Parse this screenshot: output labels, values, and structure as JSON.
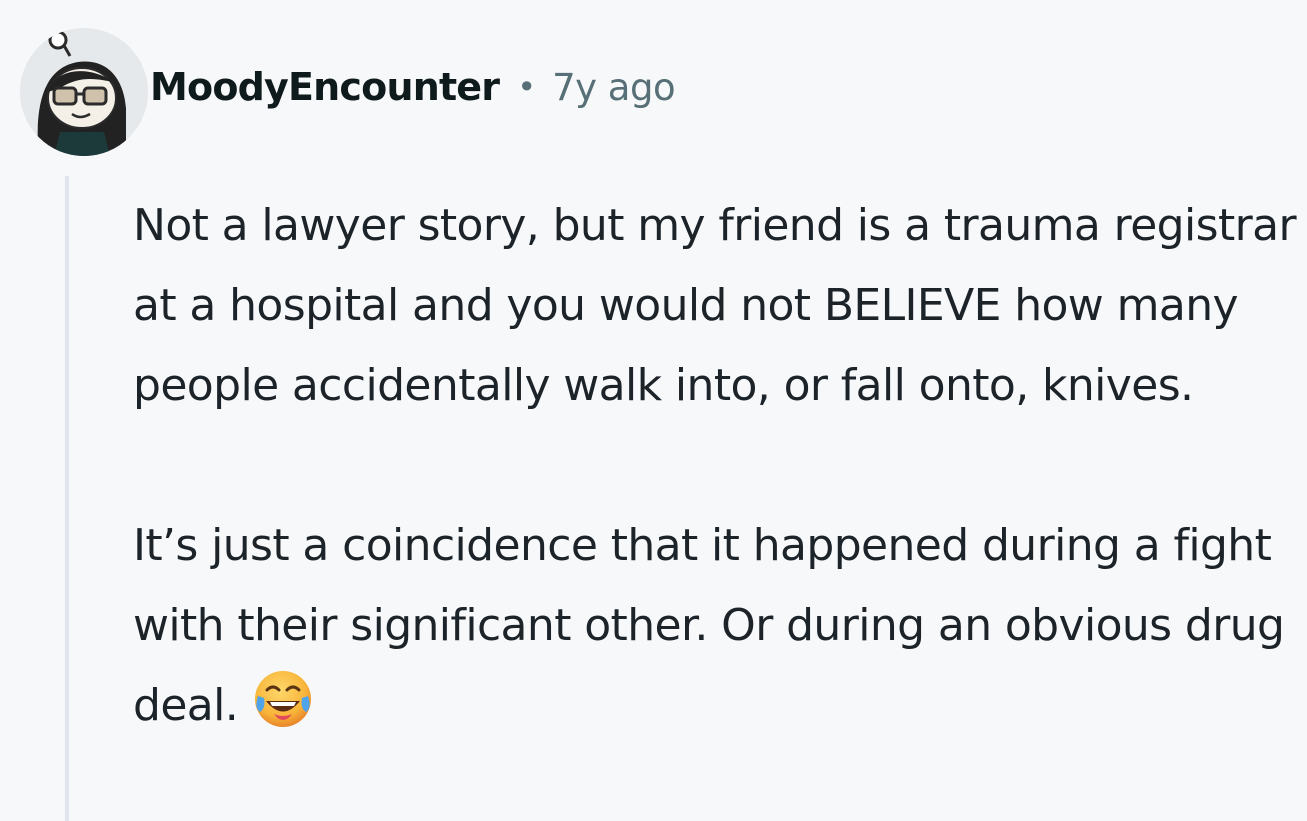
{
  "comment": {
    "username": "MoodyEncounter",
    "separator": "•",
    "timestamp": "7y ago",
    "avatar_icon": "snoo-avatar-icon",
    "paragraphs": [
      "Not a lawyer story, but my friend is a trauma registrar at a hospital and you would not BELIEVE how many people accidentally walk into, or fall onto, knives.",
      "It’s just a coincidence that it happened during a fight with their significant other. Or during an obvious drug deal."
    ],
    "emoji_icon": "face-with-tears-of-joy-icon"
  },
  "colors": {
    "background": "#f7f8fa",
    "text": "#1c2329",
    "meta_text": "#576f76",
    "thread_line": "#dfe5ea"
  }
}
